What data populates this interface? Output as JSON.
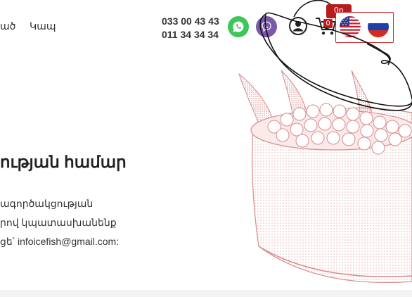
{
  "nav": {
    "items": [
      {
        "label": "ած"
      },
      {
        "label": "Կապ"
      }
    ]
  },
  "contacts": {
    "phone1": "033 00 43 43",
    "phone2": "011 34 34 34"
  },
  "icons": {
    "whatsapp": "whatsapp-icon",
    "viber": "viber-icon",
    "user": "user-icon",
    "cart": "cart-icon"
  },
  "cart": {
    "count": "0",
    "price_tab": "0դ"
  },
  "languages": [
    {
      "code": "en",
      "icon": "us-flag-icon"
    },
    {
      "code": "ru",
      "icon": "ru-flag-icon"
    }
  ],
  "main": {
    "heading": "ության համար",
    "lines": [
      "ագործակցության",
      "րով կպատասխանենք",
      "ցե՝ infoicefish@gmail.com:"
    ]
  },
  "colors": {
    "accent": "#c0181c",
    "whatsapp": "#3ec65a",
    "viber": "#7a5aa8",
    "illustration": "#e8a6a6"
  }
}
